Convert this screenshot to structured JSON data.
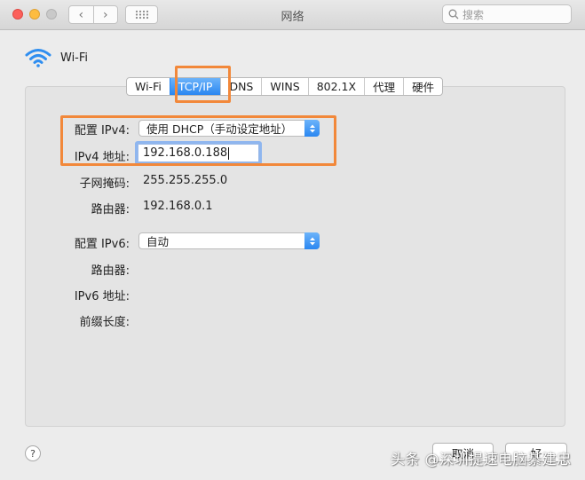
{
  "window": {
    "title": "网络"
  },
  "toolbar": {
    "back_glyph": "‹",
    "forward_glyph": "›",
    "search_placeholder": "搜索"
  },
  "interface": {
    "name": "Wi-Fi",
    "icon": "wifi-icon"
  },
  "tabs": [
    {
      "label": "Wi-Fi",
      "active": false
    },
    {
      "label": "TCP/IP",
      "active": true
    },
    {
      "label": "DNS",
      "active": false
    },
    {
      "label": "WINS",
      "active": false
    },
    {
      "label": "802.1X",
      "active": false
    },
    {
      "label": "代理",
      "active": false
    },
    {
      "label": "硬件",
      "active": false
    }
  ],
  "ipv4": {
    "configure_label": "配置 IPv4:",
    "configure_value": "使用 DHCP（手动设定地址）",
    "address_label": "IPv4 地址:",
    "address_value": "192.168.0.188",
    "subnet_label": "子网掩码:",
    "subnet_value": "255.255.255.0",
    "router_label": "路由器:",
    "router_value": "192.168.0.1"
  },
  "ipv6": {
    "configure_label": "配置 IPv6:",
    "configure_value": "自动",
    "router_label": "路由器:",
    "address_label": "IPv6 地址:",
    "prefix_label": "前缀长度:"
  },
  "footer": {
    "help_glyph": "?",
    "cancel_label": "取消",
    "ok_label": "好"
  },
  "watermark": "头条 @深圳提速电脑綦建忠",
  "colors": {
    "accent": "#2a87f1",
    "highlight": "#f2883a",
    "close": "#fc605b",
    "minimize": "#fdbc40"
  }
}
